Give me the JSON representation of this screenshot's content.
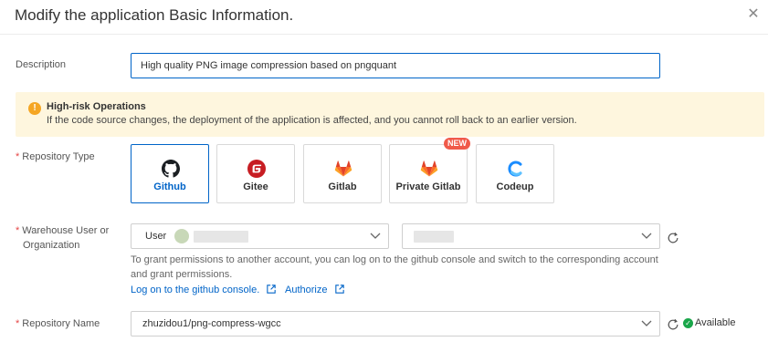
{
  "dialog": {
    "title": "Modify the application Basic Information.",
    "close_icon": "close-icon"
  },
  "description": {
    "label": "Description",
    "value": "High quality PNG image compression based on pngquant"
  },
  "warning": {
    "icon": "warning-icon",
    "title": "High-risk Operations",
    "text": "If the code source changes, the deployment of the application is affected, and you cannot roll back to an earlier version."
  },
  "repository_type": {
    "required_mark": "*",
    "label": "Repository Type",
    "options": [
      {
        "name": "Github",
        "icon": "github-icon",
        "selected": true
      },
      {
        "name": "Gitee",
        "icon": "gitee-icon"
      },
      {
        "name": "Gitlab",
        "icon": "gitlab-icon"
      },
      {
        "name": "Private Gitlab",
        "icon": "gitlab-icon",
        "badge": "NEW"
      },
      {
        "name": "Codeup",
        "icon": "codeup-icon"
      }
    ]
  },
  "warehouse": {
    "required_mark": "*",
    "label_line1": "Warehouse User or",
    "label_line2": "Organization",
    "user_prefix": "User",
    "hint_line1": "To grant permissions to another account, you can log on to the github console and switch to the corresponding account",
    "hint_line2": "and grant permissions.",
    "link_console": "Log on to the github console.",
    "link_authorize": "Authorize"
  },
  "repository_name": {
    "required_mark": "*",
    "label": "Repository Name",
    "value": "zhuzidou1/png-compress-wgcc",
    "status": "Available"
  },
  "colors": {
    "accent": "#0064c8",
    "warning_bg": "#fef6de",
    "success": "#1aa64a",
    "required": "#e54545"
  }
}
